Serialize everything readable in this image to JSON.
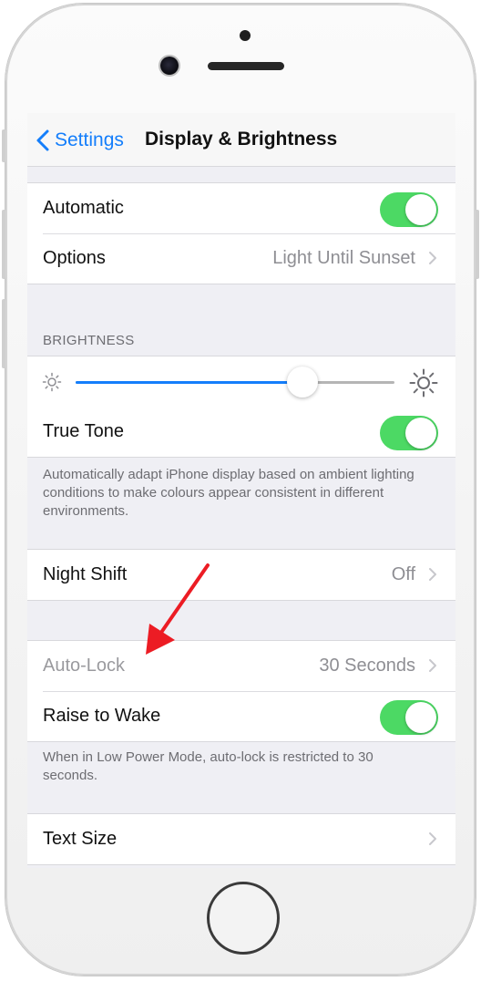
{
  "nav": {
    "back_label": "Settings",
    "title": "Display & Brightness"
  },
  "appearance_group": {
    "automatic_label": "Automatic",
    "automatic_on": true,
    "options_label": "Options",
    "options_value": "Light Until Sunset"
  },
  "brightness": {
    "header": "BRIGHTNESS",
    "level": 0.71,
    "true_tone_label": "True Tone",
    "true_tone_on": true,
    "true_tone_footer": "Automatically adapt iPhone display based on ambient lighting conditions to make colours appear consistent in different environments."
  },
  "night_shift": {
    "label": "Night Shift",
    "value": "Off"
  },
  "lock_group": {
    "auto_lock_label": "Auto-Lock",
    "auto_lock_value": "30 Seconds",
    "auto_lock_disabled": true,
    "raise_to_wake_label": "Raise to Wake",
    "raise_to_wake_on": true,
    "footer": "When in Low Power Mode, auto-lock is restricted to 30 seconds."
  },
  "text_size": {
    "label": "Text Size"
  },
  "icons": {
    "back": "chevron-left-icon",
    "disclosure": "chevron-right-icon",
    "brightness_low": "sun-small-icon",
    "brightness_high": "sun-large-icon",
    "annotation": "red-arrow-icon"
  },
  "colors": {
    "accent_blue": "#147efb",
    "toggle_green": "#4cd964",
    "annotation_red": "#ec1c24",
    "background": "#efeff4"
  }
}
